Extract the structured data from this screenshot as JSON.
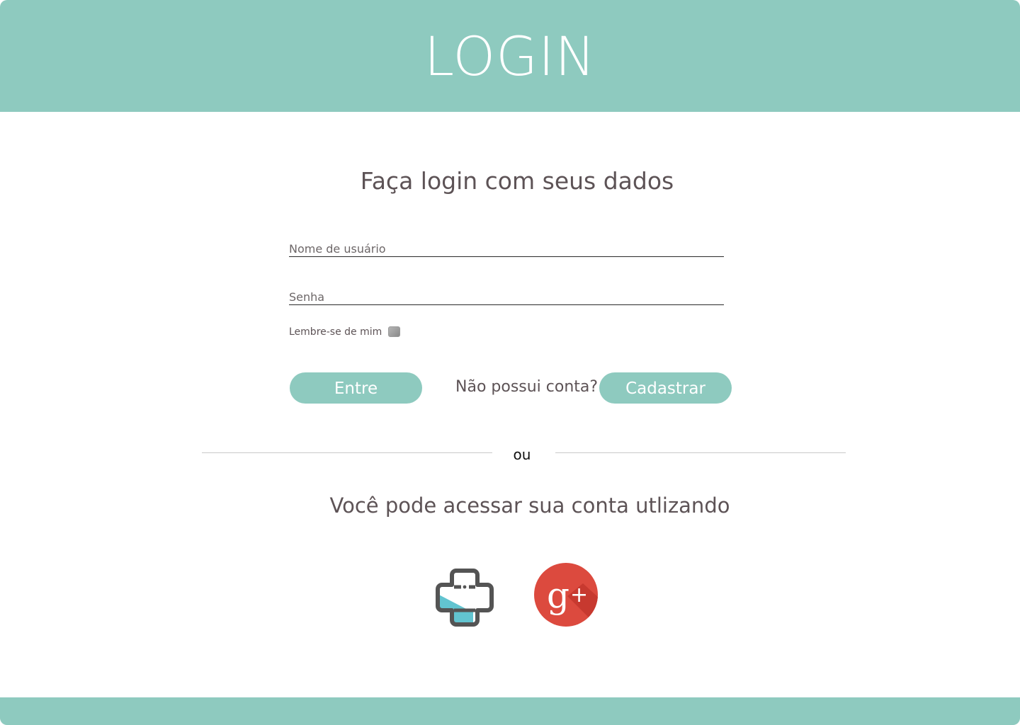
{
  "header": {
    "title": "LOGIN"
  },
  "form": {
    "subtitle": "Faça login com seus dados",
    "username_placeholder": "Nome de usuário",
    "password_placeholder": "Senha",
    "remember_label": "Lembre-se de mim",
    "remember_checked": false
  },
  "actions": {
    "enter_label": "Entre",
    "no_account_text": "Não possui conta?",
    "register_label": "Cadastrar"
  },
  "divider": {
    "text": "ou"
  },
  "social": {
    "text": "Você pode acessar sua conta utlizando",
    "icons": [
      "medical-cross-icon",
      "google-plus-icon"
    ]
  },
  "colors": {
    "accent": "#8ecabf",
    "text": "#5d5356",
    "google_red": "#dc4a3e",
    "cross_fill": "#62c4d0",
    "cross_outline": "#545454"
  }
}
